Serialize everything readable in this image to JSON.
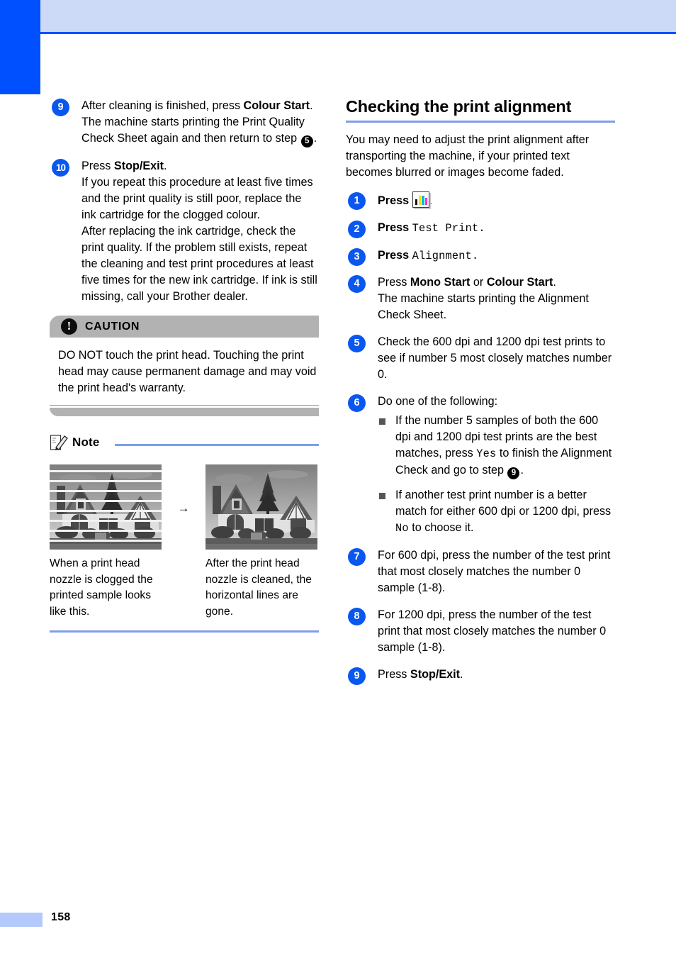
{
  "page": {
    "number": "158",
    "accent_blue": "#0050ff",
    "header_band": "#ccdaf8",
    "rule_blue": "#7e9ee8"
  },
  "left_column": {
    "steps": [
      {
        "badge": "9",
        "lines": [
          "After cleaning is finished, press ",
          "Colour Start",
          ".",
          "The machine starts printing the Print Quality Check Sheet again and then return to step ",
          "5",
          "."
        ],
        "text_a": "After cleaning is finished, press ",
        "bold_a": "Colour Start",
        "text_b": ".",
        "text_c": "The machine starts printing the Print Quality Check Sheet again and then return to step ",
        "ref": "5",
        "text_d": "."
      },
      {
        "badge": "10",
        "text_a": "Press ",
        "bold_a": "Stop/Exit",
        "text_b": ".",
        "text_c": "If you repeat this procedure at least five times and the print quality is still poor, replace the ink cartridge for the clogged colour.",
        "text_d": "After replacing the ink cartridge, check the print quality. If the problem still exists, repeat the cleaning and test print procedures at least five times for the new ink cartridge. If ink is still missing, call your Brother dealer."
      }
    ],
    "caution": {
      "icon_glyph": "!",
      "label": "CAUTION",
      "body": "DO NOT touch the print head. Touching the print head may cause permanent damage and may void the print head's warranty."
    },
    "note": {
      "label": "Note",
      "arrow": "→",
      "figures": [
        {
          "caption": "When a print head nozzle is clogged the printed sample looks like this.",
          "state": "clogged"
        },
        {
          "caption": "After the print head nozzle is cleaned, the horizontal lines are gone.",
          "state": "cleaned"
        }
      ]
    }
  },
  "right_column": {
    "title": "Checking the print alignment",
    "intro": "You may need to adjust the print alignment after transporting the machine, if your printed text becomes blurred or images become faded.",
    "steps": [
      {
        "badge": "1",
        "text_a": "Press ",
        "icon": "ink-key-icon",
        "text_b": "."
      },
      {
        "badge": "2",
        "bold_a": "Press ",
        "mono_a": "Test Print",
        "text_b": "."
      },
      {
        "badge": "3",
        "bold_a": "Press ",
        "mono_a": "Alignment",
        "text_b": "."
      },
      {
        "badge": "4",
        "text_a": "Press ",
        "bold_a": "Mono Start",
        "text_b": " or ",
        "bold_b": "Colour Start",
        "text_c": ".",
        "text_d": "The machine starts printing the Alignment Check Sheet."
      },
      {
        "badge": "5",
        "text_a": "Check the 600 dpi and 1200 dpi test prints to see if number 5 most closely matches number 0."
      },
      {
        "badge": "6",
        "text_a": "Do one of the following:",
        "bullets": [
          {
            "text_a": "If the number 5 samples of both the 600 dpi and 1200 dpi test prints are the best matches, press ",
            "mono_a": "Yes",
            "text_b": " to finish the Alignment Check and go to step ",
            "ref": "9",
            "text_c": "."
          },
          {
            "text_a": "If another test print number is a better match for either 600 dpi or 1200 dpi, press ",
            "mono_a": "No",
            "text_b": " to choose it."
          }
        ]
      },
      {
        "badge": "7",
        "text_a": "For 600 dpi, press the number of the test print that most closely matches the number 0 sample (1-8)."
      },
      {
        "badge": "8",
        "text_a": "For 1200 dpi, press the number of the test print that most closely matches the number 0 sample (1-8)."
      },
      {
        "badge": "9",
        "text_a": "Press ",
        "bold_a": "Stop/Exit",
        "text_b": "."
      }
    ]
  }
}
